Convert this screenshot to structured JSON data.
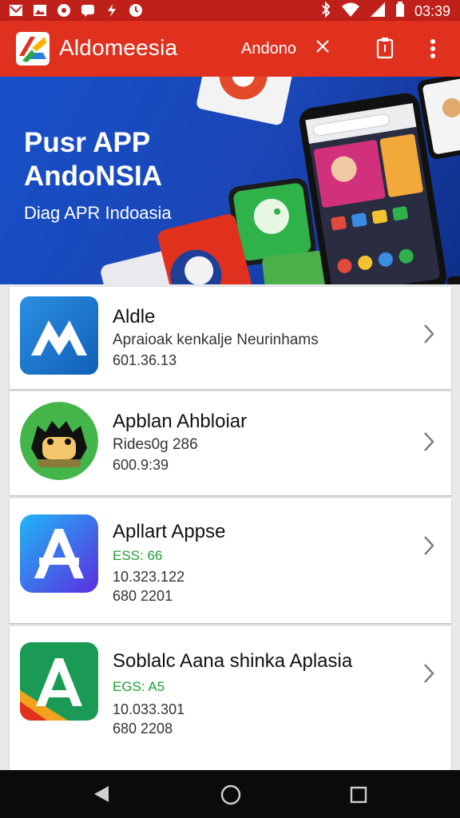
{
  "status": {
    "time": "03:39"
  },
  "appbar": {
    "brand": "Aldomeesia",
    "search_text": "Andono"
  },
  "banner": {
    "title_line1": "Pusr APP",
    "title_line2": "AndoNSIA",
    "subtitle": "Diag APR Indoasia"
  },
  "apps": [
    {
      "name": "Aldle",
      "line2": "Apraioak kenkalje Neurinhams",
      "line3": "601.36.13",
      "line4": ""
    },
    {
      "name": "Apblan Ahbloiar",
      "line2": "Rides0g 286",
      "line3": "600.9:39",
      "line4": ""
    },
    {
      "name": "Apllart Appse",
      "line2": "ESS: 66",
      "line3": "10.323.122",
      "line4": "680 2201"
    },
    {
      "name": "Soblalc Aana shinka Aplasia",
      "line2": "EGS: A5",
      "line3": "10.033.301",
      "line4": "680 2208"
    }
  ],
  "colors": {
    "appbar": "#e0311f",
    "statusbar": "#c0201a",
    "banner": "#1750c9",
    "price_green": "#1e9e32"
  },
  "icons": {
    "status_left": [
      "notification-mail-icon",
      "image-icon",
      "sync-icon",
      "chat-icon",
      "flash-icon",
      "clock-icon"
    ],
    "status_right": [
      "bluetooth-icon",
      "wifi-icon",
      "signal-icon",
      "battery-icon"
    ],
    "nav": [
      "back-icon",
      "home-icon",
      "recents-icon"
    ]
  }
}
